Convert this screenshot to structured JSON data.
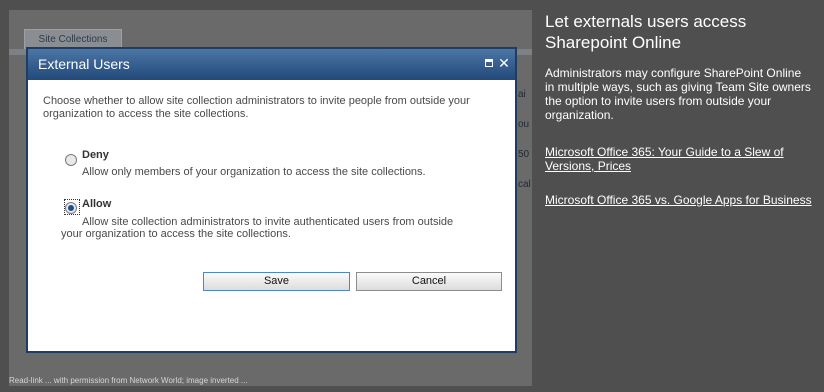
{
  "background_page": {
    "tab_label": "Site Collections",
    "partial_right_glyphs": [
      "ai",
      "ou",
      "50",
      "cal"
    ],
    "caption": "Read-link ... with permission from Network World; image inverted ..."
  },
  "dialog": {
    "title": "External Users",
    "intro": "Choose whether to allow site collection administrators to invite people from outside your organization to access the site collections.",
    "options": [
      {
        "label": "Deny",
        "description": "Allow only members of your organization to access the site collections.",
        "selected": false
      },
      {
        "label": "Allow",
        "description": "Allow site collection administrators to invite authenticated users from outside your organization to access the site collections.",
        "selected": true
      }
    ],
    "buttons": {
      "save": "Save",
      "cancel": "Cancel"
    },
    "icons": [
      "maximize-icon",
      "close-icon"
    ]
  },
  "sidebar": {
    "title": "Let externals users access Sharepoint Online",
    "description": "Administrators may configure SharePoint Online in multiple ways, such as giving Team Site owners the option to invite users from outside your organization.",
    "links": [
      "Microsoft Office 365: Your Guide to a Slew of Versions, Prices",
      "Microsoft Office 365 vs. Google Apps for Business"
    ]
  },
  "colors": {
    "page_background": "#4f4f4f",
    "dialog_title_bar": "#21497a",
    "link_color": "#ffffff"
  }
}
